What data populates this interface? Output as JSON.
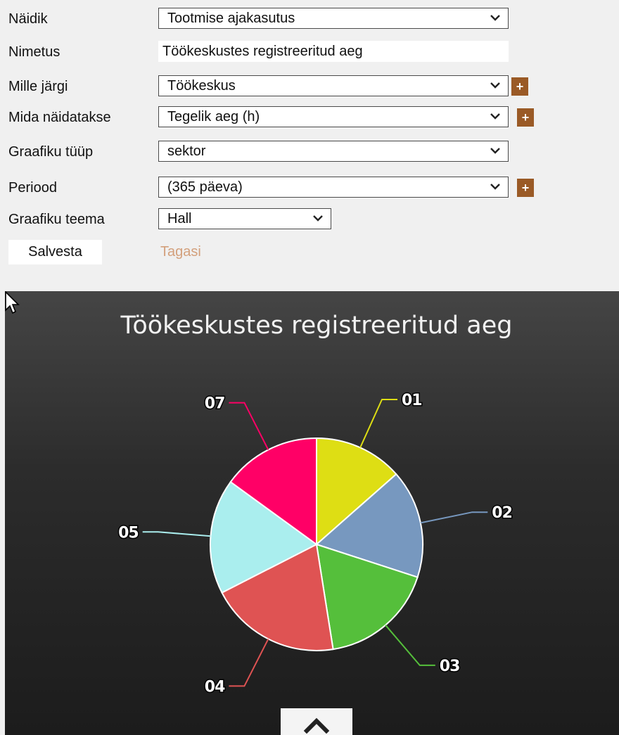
{
  "form": {
    "indicator": {
      "label": "Näidik",
      "value": "Tootmise ajakasutus"
    },
    "name": {
      "label": "Nimetus",
      "value": "Töökeskustes registreeritud aeg"
    },
    "group_by": {
      "label": "Mille järgi",
      "value": "Töökeskus",
      "plus": "+"
    },
    "measure": {
      "label": "Mida näidatakse",
      "value": "Tegelik aeg (h)",
      "plus": "+"
    },
    "chart_type": {
      "label": "Graafiku tüüp",
      "value": "sektor"
    },
    "period": {
      "label": "Periood",
      "value": "(365 päeva)",
      "plus": "+"
    },
    "theme": {
      "label": "Graafiku teema",
      "value": "Hall"
    },
    "save_label": "Salvesta",
    "back_label": "Tagasi"
  },
  "colors": {
    "plus_button": "#9a5a26",
    "back_link": "#d3a07c",
    "chart_background": "#2c2c2c"
  },
  "icons": {
    "dropdown": "chevron-down-icon",
    "scroll_up": "chevron-up-icon",
    "pointer": "mouse-cursor-icon"
  },
  "chart_data": {
    "type": "pie",
    "title": "Töökeskustes registreeritud aeg",
    "categories": [
      "01",
      "02",
      "03",
      "04",
      "05",
      "07"
    ],
    "values": [
      13.5,
      16.5,
      17.5,
      20,
      17.5,
      15
    ],
    "colors": [
      "#dede14",
      "#7798bf",
      "#55bf3b",
      "#df5353",
      "#aaeeee",
      "#ff0066"
    ],
    "legend": "none",
    "slice_border": "#ffffff"
  }
}
